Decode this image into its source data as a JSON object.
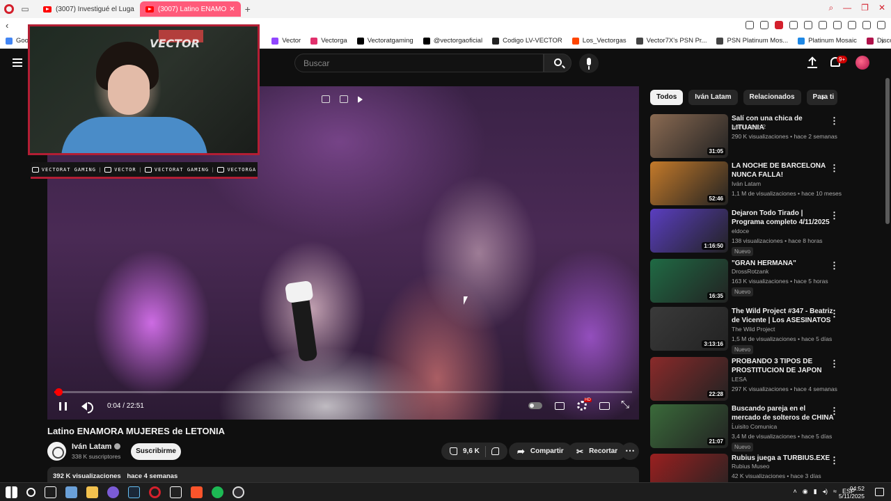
{
  "browser": {
    "tabs": [
      {
        "label": "(3007) Investigué el Luga",
        "active": false
      },
      {
        "label": "(3007) Latino ENAMO",
        "active": true
      }
    ],
    "bookmarks": [
      {
        "label": "Goog",
        "color": "#4285f4"
      },
      {
        "label": "Vector",
        "color": "#9146ff"
      },
      {
        "label": "Vectorga",
        "color": "#e1306c"
      },
      {
        "label": "Vectoratgaming",
        "color": "#000000"
      },
      {
        "label": "@vectorgaoficial",
        "color": "#000000"
      },
      {
        "label": "Codigo LV-VECTOR",
        "color": "#222222"
      },
      {
        "label": "Los_Vectorgas",
        "color": "#ff4500"
      },
      {
        "label": "Vector7X's PSN Pr...",
        "color": "#444444"
      },
      {
        "label": "PSN Platinum Mos...",
        "color": "#444444"
      },
      {
        "label": "Platinum Mosaic",
        "color": "#1e88e5"
      },
      {
        "label": "Discover Games -...",
        "color": "#b0124a"
      }
    ]
  },
  "header": {
    "search_placeholder": "Buscar",
    "notifications_badge": "9+"
  },
  "player": {
    "time": "0:04 / 22:51",
    "progress_fraction": 0.003
  },
  "overlay": {
    "brand": "VECTOR",
    "socials": [
      {
        "label": "VECTORAT GAMING"
      },
      {
        "label": "VECTOR"
      },
      {
        "label": "VECTORAT GAMING"
      },
      {
        "label": "VECTORGA"
      }
    ]
  },
  "video": {
    "title": "Latino ENAMORA MUJERES de LETONIA",
    "channel": "Iván Latam",
    "subscribers": "338 K suscriptores",
    "subscribe_label": "Suscribirme",
    "likes": "9,6 K",
    "share_label": "Compartir",
    "clip_label": "Recortar",
    "views": "392 K visualizaciones",
    "published": "hace 4 semanas"
  },
  "sidebar": {
    "chips": [
      "Todos",
      "Iván Latam",
      "Relacionados",
      "Para ti"
    ],
    "recommendations": [
      {
        "title": "Salí con una chica de LITUANIA",
        "channel": "Iván Latam 2",
        "meta": "290 K visualizaciones • hace 2 semanas",
        "duration": "31:05",
        "nuevo": "",
        "thumb": "#8a6a52"
      },
      {
        "title": "LA NOCHE DE BARCELONA NUNCA FALLA!",
        "channel": "Iván Latam",
        "meta": "1,1 M de visualizaciones • hace 10 meses",
        "duration": "52:46",
        "nuevo": "",
        "thumb": "#c47a2a"
      },
      {
        "title": "Dejaron Todo Tirado | Programa completo 4/11/2025",
        "channel": "eldoce",
        "meta": "138 visualizaciones • hace 8 horas",
        "duration": "1:16:50",
        "nuevo": "Nuevo",
        "thumb": "#5a3ec0"
      },
      {
        "title": "\"GRAN HERMANA\"",
        "channel": "DrossRotzank",
        "meta": "163 K visualizaciones • hace 5 horas",
        "duration": "16:35",
        "nuevo": "Nuevo",
        "thumb": "#1f6a44"
      },
      {
        "title": "The Wild Project #347 - Beatriz de Vicente | Los ASESINATOS ...",
        "channel": "The Wild Project",
        "meta": "1,5 M de visualizaciones • hace 5 días",
        "duration": "3:13:16",
        "nuevo": "Nuevo",
        "thumb": "#3a3a3a"
      },
      {
        "title": "PROBANDO 3 TIPOS DE PROSTITUCION DE JAPON",
        "channel": "LESA",
        "meta": "297 K visualizaciones • hace 4 semanas",
        "duration": "22:28",
        "nuevo": "",
        "thumb": "#8a2a2a"
      },
      {
        "title": "Buscando pareja en el mercado de solteros de CHINA | ¡Me sa...",
        "channel": "Luisito Comunica",
        "meta": "3,4 M de visualizaciones • hace 5 días",
        "duration": "21:07",
        "nuevo": "Nuevo",
        "thumb": "#3a6a3a"
      },
      {
        "title": "Rubius juega a TURBIUS.EXE",
        "channel": "Rubius Museo",
        "meta": "42 K visualizaciones • hace 3 días",
        "duration": "",
        "nuevo": "",
        "thumb": "#9a2020"
      }
    ]
  },
  "taskbar": {
    "lang": "ESP",
    "time": "04:52",
    "date": "5/11/2025"
  }
}
